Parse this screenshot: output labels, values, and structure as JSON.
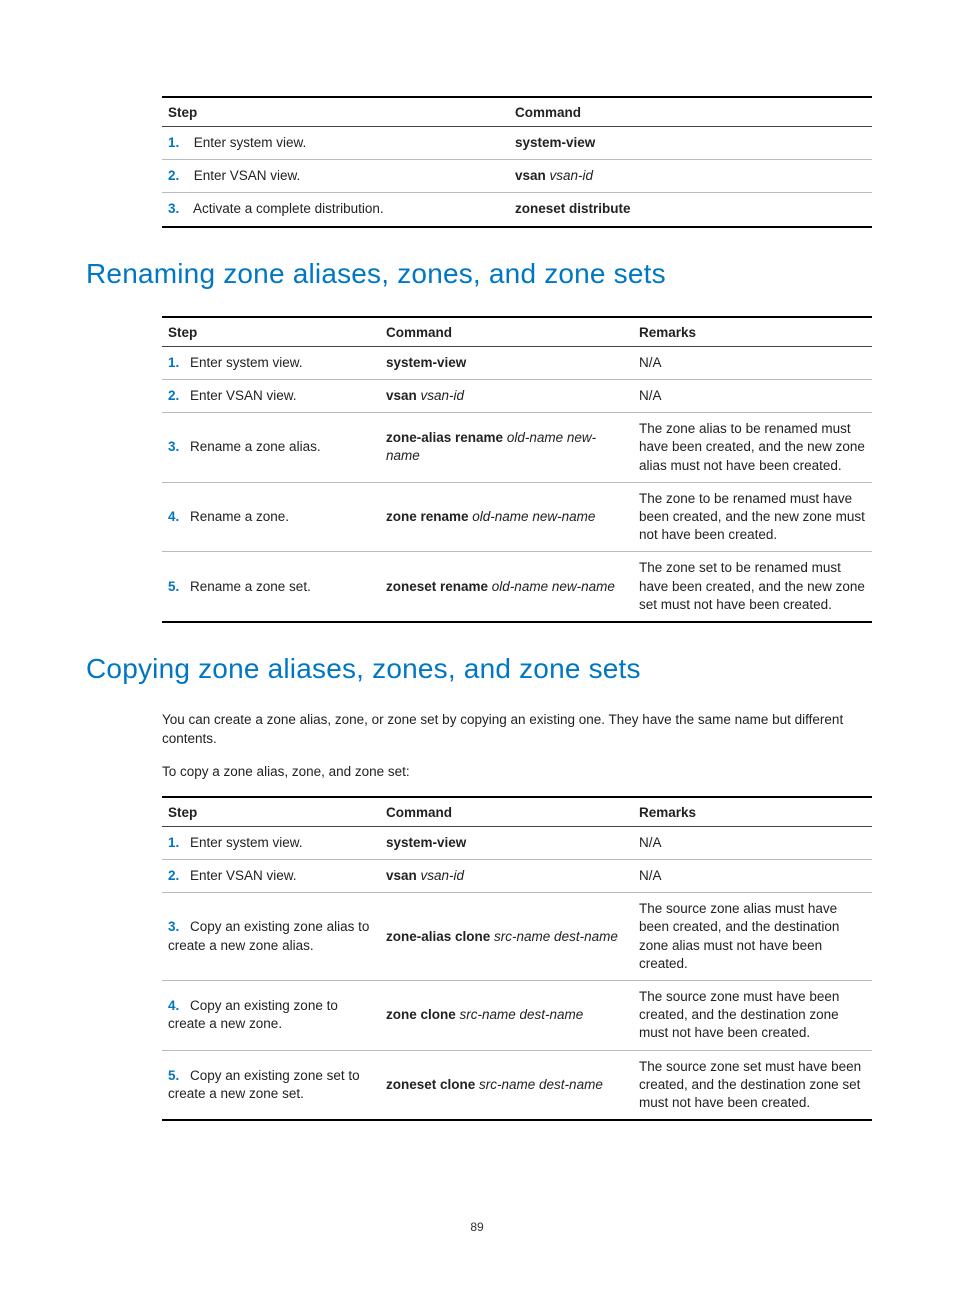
{
  "headers": {
    "step": "Step",
    "command": "Command",
    "remarks": "Remarks"
  },
  "table1": {
    "rows": [
      {
        "n": "1.",
        "step": "Enter system view.",
        "cmd_bold": "system-view",
        "cmd_italic": ""
      },
      {
        "n": "2.",
        "step": "Enter VSAN view.",
        "cmd_bold": "vsan",
        "cmd_italic": " vsan-id"
      },
      {
        "n": "3.",
        "step": "Activate a complete distribution.",
        "cmd_bold": "zoneset distribute",
        "cmd_italic": ""
      }
    ]
  },
  "heading1": "Renaming zone aliases, zones, and zone sets",
  "table2": {
    "rows": [
      {
        "n": "1.",
        "step": "Enter system view.",
        "cmd_bold": "system-view",
        "cmd_italic": "",
        "remarks": "N/A"
      },
      {
        "n": "2.",
        "step": "Enter VSAN view.",
        "cmd_bold": "vsan",
        "cmd_italic": " vsan-id",
        "remarks": "N/A"
      },
      {
        "n": "3.",
        "step": "Rename a zone alias.",
        "cmd_bold": "zone-alias rename",
        "cmd_italic": " old-name new-name",
        "remarks": "The zone alias to be renamed must have been created, and the new zone alias must not have been created."
      },
      {
        "n": "4.",
        "step": "Rename a zone.",
        "cmd_bold": "zone rename",
        "cmd_italic": " old-name new-name",
        "remarks": "The zone to be renamed must have been created, and the new zone must not have been created."
      },
      {
        "n": "5.",
        "step": "Rename a zone set.",
        "cmd_bold": "zoneset rename",
        "cmd_italic": " old-name new-name",
        "remarks": "The zone set to be renamed must have been created, and the new zone set must not have been created."
      }
    ]
  },
  "heading2": "Copying zone aliases, zones, and zone sets",
  "para1": "You can create a zone alias, zone, or zone set by copying an existing one. They have the same name but different contents.",
  "para2": "To copy a zone alias, zone, and zone set:",
  "table3": {
    "rows": [
      {
        "n": "1.",
        "step": "Enter system view.",
        "cmd_bold": "system-view",
        "cmd_italic": "",
        "remarks": "N/A"
      },
      {
        "n": "2.",
        "step": "Enter VSAN view.",
        "cmd_bold": "vsan",
        "cmd_italic": " vsan-id",
        "remarks": "N/A"
      },
      {
        "n": "3.",
        "step": "Copy an existing zone alias to create a new zone alias.",
        "cmd_bold": "zone-alias clone",
        "cmd_italic": " src-name dest-name",
        "remarks": "The source zone alias must have been created, and the destination zone alias must not have been created."
      },
      {
        "n": "4.",
        "step": "Copy an existing zone to create a new zone.",
        "cmd_bold": "zone clone",
        "cmd_italic": " src-name dest-name",
        "remarks": "The source zone must have been created, and the destination zone must not have been created."
      },
      {
        "n": "5.",
        "step": "Copy an existing zone set to create a new zone set.",
        "cmd_bold": "zoneset clone",
        "cmd_italic": " src-name dest-name",
        "remarks": "The source zone set must have been created, and the destination zone set must not have been created."
      }
    ]
  },
  "page_number": "89"
}
